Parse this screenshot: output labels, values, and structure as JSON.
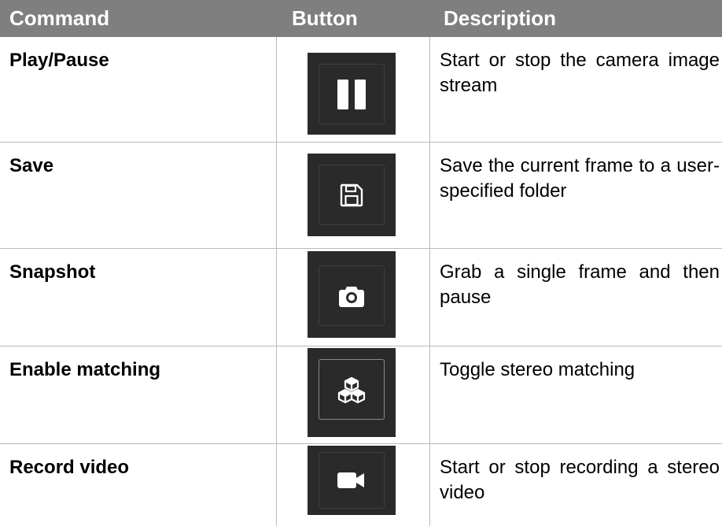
{
  "header": {
    "command": "Command",
    "button": "Button",
    "description": "Description"
  },
  "rows": [
    {
      "command": "Play/Pause",
      "icon": "pause-icon",
      "description": "Start or stop the camera image stream"
    },
    {
      "command": "Save",
      "icon": "floppy-disk-icon",
      "description": "Save the current frame to a user-specified folder"
    },
    {
      "command": "Snapshot",
      "icon": "camera-icon",
      "description": "Grab a single frame and then pause"
    },
    {
      "command": "Enable matching",
      "icon": "cubes-icon",
      "description": "Toggle stereo matching"
    },
    {
      "command": "Record video",
      "icon": "video-camera-icon",
      "description": "Start or stop recording a stereo video"
    }
  ],
  "colors": {
    "header_bg": "#7f7f7f",
    "header_text": "#ffffff",
    "button_panel_bg": "#2a2a2a",
    "icon": "#ffffff",
    "grid_line": "#b9b9b9"
  }
}
